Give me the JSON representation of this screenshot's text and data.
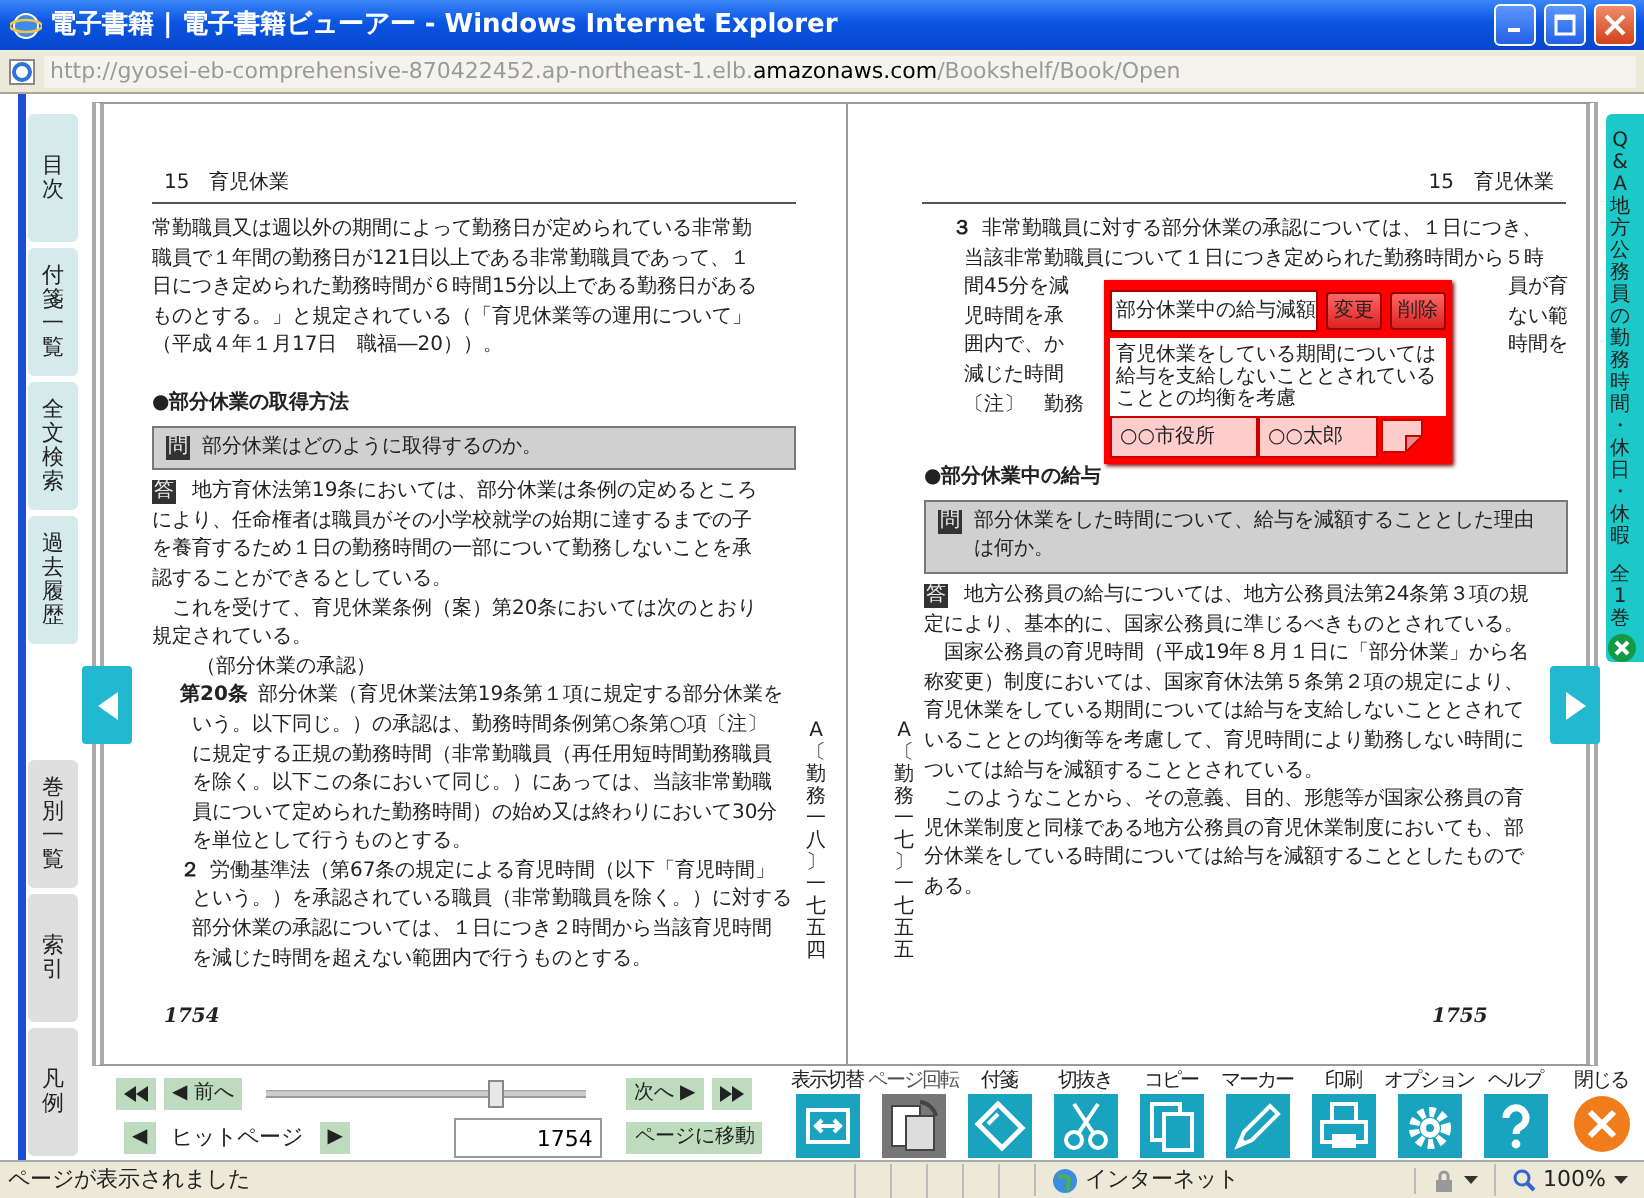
{
  "window": {
    "title": "電子書籍 | 電子書籍ビューアー - Windows Internet Explorer",
    "address": "http://gyosei-eb-comprehensive-870422452.ap-northeast-1.elb.**amazonaws.com**/Bookshelf/Book/Open"
  },
  "side_tabs": [
    {
      "label": "目次",
      "kind": "tool"
    },
    {
      "label": "付箋一覧",
      "kind": "tool"
    },
    {
      "label": "全文検索",
      "kind": "tool"
    },
    {
      "label": "過去履歴",
      "kind": "tool"
    },
    {
      "label": "巻別一覧",
      "kind": "book"
    },
    {
      "label": "索引",
      "kind": "book"
    },
    {
      "label": "凡例",
      "kind": "book"
    }
  ],
  "left_page": {
    "header": "15　育児休業",
    "page_number": "1754",
    "margin_note": "A〔勤務一八〕一七五四",
    "blocks": [
      {
        "kind": "para",
        "lines": [
          "常勤職員又は週以外の期間によって勤務日が定められている非常勤",
          "職員で１年間の勤務日が121日以上である非常勤職員であって、１",
          "日につき定められた勤務時間が６時間15分以上である勤務日がある",
          "ものとする。」と規定されている（「育児休業等の運用について」",
          "（平成４年１月17日　職福―20））。"
        ]
      },
      {
        "kind": "heading",
        "text": "●部分休業の取得方法"
      },
      {
        "kind": "question",
        "mark": "問",
        "lines": [
          "部分休業はどのように取得するのか。"
        ]
      },
      {
        "kind": "answer",
        "mark": "答",
        "lines": [
          "地方育休法第19条においては、部分休業は条例の定めるところ",
          "により、任命権者は職員がその小学校就学の始期に達するまでの子",
          "を養育するため１日の勤務時間の一部について勤務しないことを承",
          "認することができるとしている。"
        ]
      },
      {
        "kind": "para",
        "lines": [
          "　これを受けて、育児休業条例（案）第20条においては次のとおり",
          "規定されている。"
        ]
      },
      {
        "kind": "caption",
        "text": "（部分休業の承認）"
      },
      {
        "kind": "article",
        "number": "第20条",
        "lines": [
          "部分休業（育児休業法第19条第１項に規定する部分休業を",
          "いう。以下同じ。）の承認は、勤務時間条例第○条第○項〔注〕",
          "に規定する正規の勤務時間（非常勤職員（再任用短時間勤務職員",
          "を除く。以下この条において同じ。）にあっては、当該非常勤職",
          "員について定められた勤務時間）の始め又は終わりにおいて30分",
          "を単位として行うものとする。"
        ]
      },
      {
        "kind": "article",
        "number": "２",
        "lines": [
          "労働基準法（第67条の規定による育児時間（以下「育児時間」",
          "という。）を承認されている職員（非常勤職員を除く。）に対する",
          "部分休業の承認については、１日につき２時間から当該育児時間",
          "を減じた時間を超えない範囲内で行うものとする。"
        ]
      }
    ]
  },
  "right_page": {
    "header": "15　育児休業",
    "page_number": "1755",
    "margin_note": "A〔勤務一七〕一七五五",
    "blocks": [
      {
        "kind": "article",
        "number": "３",
        "lines": [
          "非常勤職員に対する部分休業の承認については、１日につき、",
          "当該非常勤職員について１日につき定められた勤務時間から５時",
          {
            "left": "間45分を減",
            "right": "員が育"
          },
          {
            "left": "児時間を承",
            "right": "ない範"
          },
          {
            "left": "囲内で、か",
            "right": "時間を"
          },
          {
            "left": "減じた時間"
          },
          {
            "left": "〔注〕　勤務"
          }
        ]
      },
      {
        "kind": "heading",
        "text": "●部分休業中の給与"
      },
      {
        "kind": "question",
        "mark": "問",
        "lines": [
          "部分休業をした時間について、給与を減額することとした理由",
          "は何か。"
        ]
      },
      {
        "kind": "answer",
        "mark": "答",
        "lines": [
          "地方公務員の給与については、地方公務員法第24条第３項の規",
          "定により、基本的に、国家公務員に準じるべきものとされている。"
        ]
      },
      {
        "kind": "para",
        "lines": [
          "　国家公務員の育児時間（平成19年８月１日に「部分休業」から名",
          "称変更）制度においては、国家育休法第５条第２項の規定により、",
          "育児休業をしている期間については給与を支給しないこととされて",
          "いることとの均衡等を考慮して、育児時間により勤務しない時間に",
          "ついては給与を減額することとされている。"
        ]
      },
      {
        "kind": "para",
        "lines": [
          "　このようなことから、その意義、目的、形態等が国家公務員の育",
          "児休業制度と同様である地方公務員の育児休業制度においても、部",
          "分休業をしている時間については給与を減額することとしたもので",
          "ある。"
        ]
      }
    ]
  },
  "sticky_note": {
    "title": "部分休業中の給与減額",
    "buttons": [
      "変更",
      "削除"
    ],
    "memo": "育児休業をしている期間については給与を支給しないこととされていることとの均衡を考慮",
    "department": "○○市役所",
    "author": "○○太郎"
  },
  "book_panel": {
    "title": "Q&A地方公務員の勤務時間・休日・休暇",
    "volumes": "全1巻"
  },
  "toolbar": {
    "prev": "◀ 前へ",
    "next": "次へ ▶",
    "slider": {
      "level": 0.72
    },
    "hit_prev": "◀",
    "hit_label": "ヒットページ",
    "hit_next": "▶",
    "page": "1754",
    "go": "ページに移動",
    "tools": [
      {
        "label": "表示切替",
        "kind": "display",
        "disabled": false
      },
      {
        "label": "ページ回転",
        "kind": "rotate",
        "disabled": true
      },
      {
        "label": "付箋",
        "kind": "sticky",
        "disabled": false
      },
      {
        "label": "切抜き",
        "kind": "clip",
        "disabled": false
      },
      {
        "label": "コピー",
        "kind": "copy",
        "disabled": false
      },
      {
        "label": "マーカー",
        "kind": "marker",
        "disabled": false
      },
      {
        "label": "印刷",
        "kind": "print",
        "disabled": false
      },
      {
        "label": "オプション",
        "kind": "options",
        "disabled": false
      },
      {
        "label": "ヘルプ",
        "kind": "help",
        "disabled": false
      },
      {
        "label": "閉じる",
        "kind": "close",
        "disabled": false
      }
    ]
  },
  "status_bar": {
    "message": "ページが表示されました",
    "zone": "インターネット",
    "zoom": "100%"
  }
}
